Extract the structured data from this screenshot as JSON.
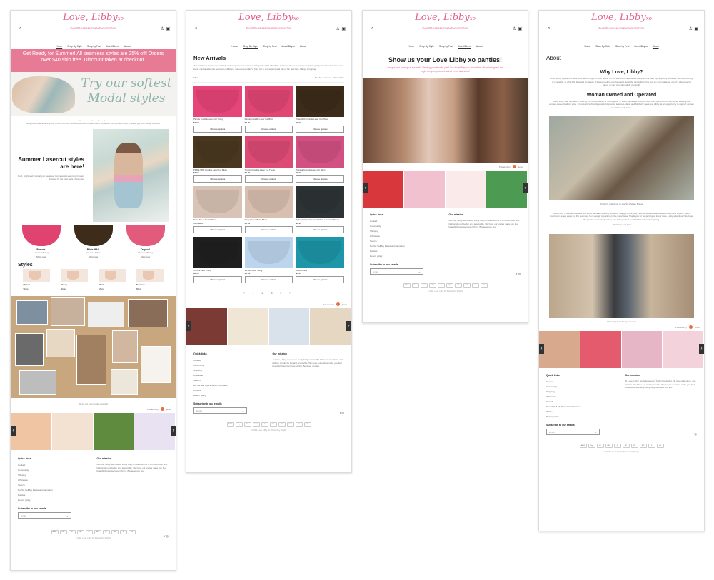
{
  "brand": {
    "name": "Love, Libby",
    "xo": "xo",
    "tagline": "#loveliBbyxo#readylitaabe#lovingtheThing",
    "accent": "#e35f8a",
    "promo_bg": "#e77a95"
  },
  "nav": {
    "home": "Home",
    "shop_by_style": "Shop By Style",
    "shop_by_feel": "Shop by Feel",
    "show": "#loveliBbyxo",
    "about": "About"
  },
  "home": {
    "promo": "Get Ready for Summer! All seamless styles are 25% off! Orders over $40 ship free. Discount taken at checkout.",
    "hero_line1": "Try our softest",
    "hero_line2": "Modal styles",
    "hero_caption": "Gorgeous, bear amazing next to skin from our fabulous bamboo modal cotton. Whatever your perfect undie is, we've got your bootie covered!",
    "summer_title": "Summer Lasercut styles are here!",
    "summer_desc": "Bold, bright and tropical, just because! Our newest Lasercut prints are inspired by the best parts of summer.",
    "products": [
      {
        "name": "Parrots",
        "sub": "Lasercut Thong",
        "btn": "Shop now",
        "color": "#e0436f"
      },
      {
        "name": "Pride MAX",
        "sub": "Lasercut Bikini",
        "btn": "Shop now",
        "color": "#7a5a2a"
      },
      {
        "name": "Tropical",
        "sub": "Lasercut Thong",
        "btn": "Shop now",
        "color": "#e25a7c"
      }
    ],
    "styles_title": "Styles",
    "styles": [
      {
        "name": "Hipster",
        "btn": "Shop"
      },
      {
        "name": "Thong",
        "btn": "Shop"
      },
      {
        "name": "Bikini",
        "btn": "Shop"
      },
      {
        "name": "Boyshort",
        "btn": "Shop"
      }
    ],
    "collage_caption": "We've got your bootie covered!"
  },
  "juicer": {
    "label": "Powered by",
    "name": "juicer"
  },
  "arrows": {
    "prev": "‹",
    "next": "›"
  },
  "footer": {
    "quick_links": "Quick links",
    "links": [
      "Contact",
      "Community",
      "Shipping",
      "Wholesale",
      "Search",
      "Do Not Sell My Personal Information",
      "Policies",
      "Return policy"
    ],
    "mission_title": "Our mission",
    "mission": "At Love, Libby, we believe every body is beautiful. life is an adventure, and fashion should be fun and accessible. We hope our undies make you feel beautiful/brave/sexy/everything. Because you are.",
    "subscribe": "Subscribe to our emails",
    "email_placeholder": "Email",
    "email_arrow": "→",
    "social": "f  ◎",
    "payments": [
      "AMEX",
      "Pay",
      "DC",
      "DSC",
      "G",
      "MC",
      "PP",
      "ShP",
      "V",
      "VS"
    ],
    "copyright": "© 2024, Love, Libby Xo Powered by Shopify"
  },
  "collection": {
    "title": "New Arrivals",
    "intro": "Just In! Check out our new arrivals, including some in extended sizing (sizes XS-3X will be coming in the next few weeks!) Our spring collection features some super comfortable, low seamless additions, our ever-popular 'V' front cut in a new print, and lots of fun new lace. Happy shopping!",
    "filter": "Filter",
    "sort": "Sort by:",
    "sort_value": "Featured",
    "count": "13 products",
    "choose": "Choose options",
    "items": [
      {
        "name": "Parrots Invisible Laser Cut Thong",
        "price": "$6.99",
        "color": "#e6457a"
      },
      {
        "name": "Parrots Invisible Laser Cut Bikini",
        "price": "$6.99",
        "color": "#e14673"
      },
      {
        "name": "Pride MAX Invisible Laser Cut Thong",
        "price": "$6.99",
        "color": "#3d2c1a"
      },
      {
        "name": "PRIDE MAX Invisible Laser Cut Bikini",
        "price": "$6.99",
        "color": "#4a3720"
      },
      {
        "name": "Tropical Invisible Laser Cut Thong",
        "price": "$6.99",
        "color": "#dd4a74"
      },
      {
        "name": "Tropical Invisible Laser Cut Bikini",
        "price": "$6.99",
        "color": "#d35083"
      },
      {
        "name": "Daisy Sheer Modal Thong",
        "price": "from $5.99",
        "color": "#d9c3b6"
      },
      {
        "name": "Daisy Sheer Modal Bikini",
        "price": "$6.99",
        "color": "#d8bfb0"
      },
      {
        "name": "Spring Wings V-Front No Show Laser Cut Thong",
        "price": "$6.99",
        "color": "#2e3436"
      },
      {
        "name": "V-Front Lace Thong",
        "price": "$6.99",
        "color": "#1f1f1f"
      },
      {
        "name": "V-Front Lace Thong",
        "price": "$6.99",
        "color": "#bcd5ee"
      },
      {
        "name": "Cotton Bikini",
        "price": "$6.99",
        "color": "#1c96a8"
      }
    ],
    "pages": "‹ 1 2 3 4 ›"
  },
  "show": {
    "title": "Show us your Love Libby xo panties!",
    "subtitle": "Just got your package in the mail? Wearing your favorite pair? Use #loveliBbyxo to show them off on Instagram! You might see your picture featured in our slideshow!"
  },
  "about": {
    "title": "About",
    "why": "Why Love, Libby?",
    "why_text": "Love, Libby represents adventure, and doing it on your terms. It's the sign-off on a postcard home from a road trip, a quickly scribbled note the morning of a new job, or what Mel first said at college. It's about getting out there and doing the things that bring you joy and challenge you. It's about feeling good, in your own skin, while you do it!",
    "women": "Woman Owned and Operated",
    "women_text": "Love, Libby was founded in 2020 by the former owner of Sol Lingerie. In 2020, Janie and Kimberly took over ownership of the brand, keeping the women-owned tradition alive. Friends since their days as kindergarten teachers, Janie and Kimberly see Love, Libby as an opportunity to support women in all their endeavors.",
    "photo1_caption": "Kimberly and Janie on the St. Charles Bridge",
    "thanks_text": "Love, Libby is a small business and we're definitely working about our sweight in the (fell) matt-dominated retail market of women's lingerie. We're involved in every aspect of the business, from design to packing in the warehouse. Thank you for supporting us in our Love, Libby adventure! We hope the panties we've designed for you help you feel beautiful/brave/sexy/everything.",
    "signoff": "~ Kimberly and Janie",
    "photo2_caption": "We've got your booty covered!"
  }
}
